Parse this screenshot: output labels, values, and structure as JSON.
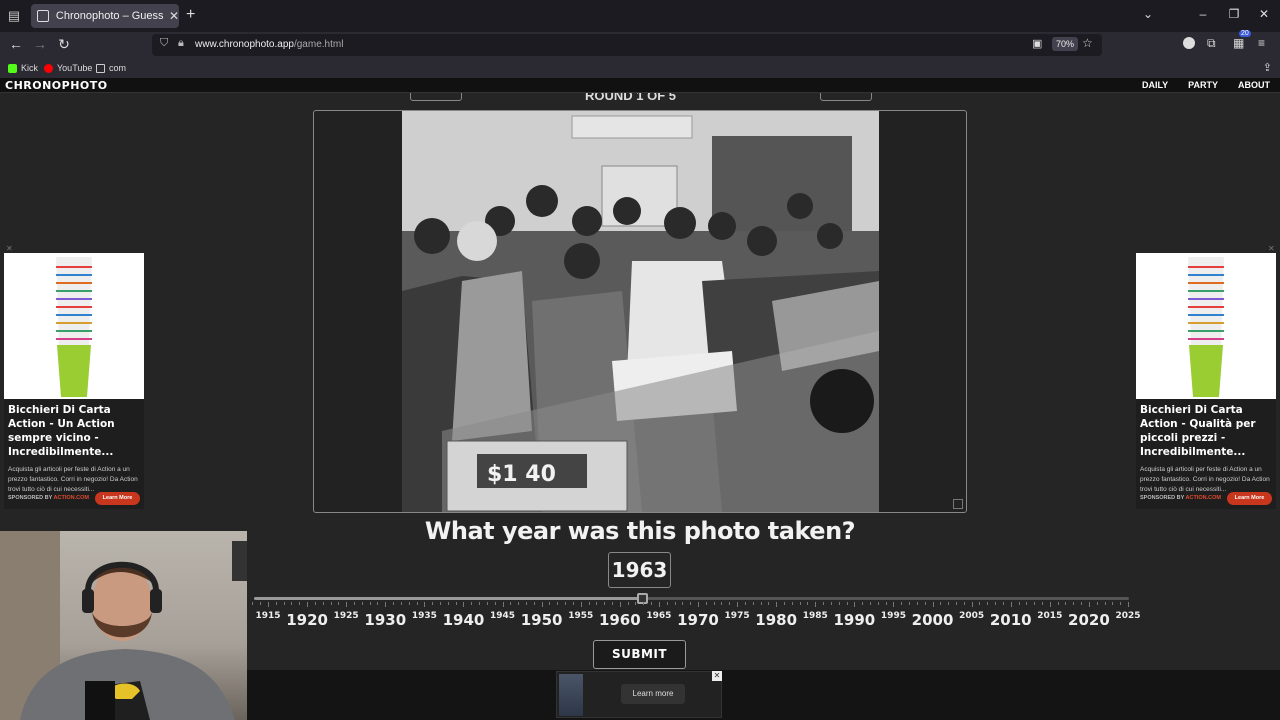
{
  "browser": {
    "tab_title": "Chronophoto – Guess the Year",
    "url_prefix": "www.chronophoto.app",
    "url_path": "/game.html",
    "zoom": "70%",
    "extension_badge": "20",
    "bookmarks": [
      {
        "label": "Kick",
        "color": "#53fc18"
      },
      {
        "label": "YouTube",
        "color": "#ff0000"
      },
      {
        "label": "com",
        "color": "#cccccc"
      }
    ]
  },
  "site": {
    "logo": "CHRONOPHOTO",
    "nav": [
      "DAILY",
      "PARTY",
      "ABOUT"
    ],
    "round_label": "ROUND 1 OF 5"
  },
  "game": {
    "question": "What year was this photo taken?",
    "selected_year": "1963",
    "slider": {
      "min": 1910,
      "max": 2025,
      "value": 1963
    },
    "major_years": [
      "1920",
      "1930",
      "1940",
      "1950",
      "1960",
      "1970",
      "1980",
      "1990",
      "2000",
      "2010",
      "2020"
    ],
    "minor_years": [
      "1915",
      "1925",
      "1935",
      "1945",
      "1955",
      "1965",
      "1975",
      "1985",
      "1995",
      "2005",
      "2015",
      "2025"
    ],
    "submit_label": "SUBMIT",
    "photo_price_tag": "$1 40"
  },
  "ads": {
    "left": {
      "title": "Bicchieri Di Carta Action - Un Action sempre vicino - Incredibilmente...",
      "body": "Acquista gli articoli per feste di Action a un prezzo fantastico. Corri in negozio! Da Action trovi tutto ciò di cui necessiti...",
      "sponsor_prefix": "SPONSORED BY",
      "sponsor": "ACTION.COM",
      "cta": "Learn More"
    },
    "right": {
      "title": "Bicchieri Di Carta Action - Qualità per piccoli prezzi - Incredibilmente...",
      "body": "Acquista gli articoli per feste di Action a un prezzo fantastico. Corri in negozio! Da Action trovi tutto ciò di cui necessiti...",
      "sponsor_prefix": "SPONSORED BY",
      "sponsor": "ACTION.COM",
      "cta": "Learn More"
    },
    "bottom": {
      "cta": "Learn more"
    }
  }
}
